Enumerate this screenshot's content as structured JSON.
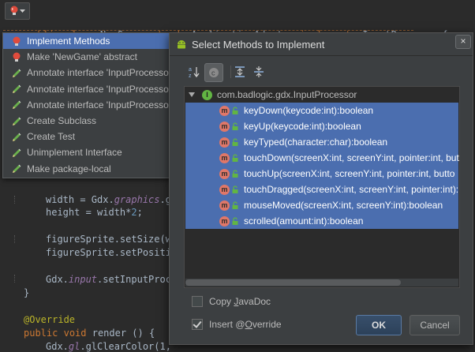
{
  "editor": {
    "class_decl": {
      "kw1": "public",
      "kw2": "class",
      "name": "NewGame",
      "kw3": "extends",
      "super": "ApplicationAdapter",
      "kw4": "implements",
      "iface": "InputProcessor{"
    },
    "lines": {
      "width_assign_pre": "width = Gdx.",
      "width_assign_field": "graphics",
      "width_assign_post": ".g",
      "height_assign_pre": "height = width*",
      "height_assign_num": "2",
      "height_assign_post": ";",
      "setsize": "figureSprite.setSize(w",
      "setpos": "figureSprite.setPositi",
      "input_pre": "Gdx.",
      "input_field": "input",
      "input_post": ".setInputProc",
      "close_brace": "}",
      "override": "@Override",
      "render_kw1": "public",
      "render_kw2": "void",
      "render_post": "render () {",
      "clear_pre": "Gdx.",
      "clear_field": "gl",
      "clear_post": ".glClearColor(1,"
    }
  },
  "intent_popup": {
    "items": [
      {
        "label": "Implement Methods",
        "icon": "red-bulb-icon"
      },
      {
        "label": "Make 'NewGame' abstract",
        "icon": "red-bulb-icon"
      },
      {
        "label": "Annotate interface 'InputProcesso",
        "icon": "pencil-icon"
      },
      {
        "label": "Annotate interface 'InputProcesso",
        "icon": "pencil-icon"
      },
      {
        "label": "Annotate interface 'InputProcesso",
        "icon": "pencil-icon"
      },
      {
        "label": "Create Subclass",
        "icon": "pencil-icon"
      },
      {
        "label": "Create Test",
        "icon": "pencil-icon"
      },
      {
        "label": "Unimplement Interface",
        "icon": "pencil-icon"
      },
      {
        "label": "Make package-local",
        "icon": "pencil-icon"
      }
    ]
  },
  "dialog": {
    "title": "Select Methods to Implement",
    "close_glyph": "×",
    "tree_root": "com.badlogic.gdx.InputProcessor",
    "root_badge": "I",
    "method_badge": "m",
    "methods": [
      "keyDown(keycode:int):boolean",
      "keyUp(keycode:int):boolean",
      "keyTyped(character:char):boolean",
      "touchDown(screenX:int, screenY:int, pointer:int, but",
      "touchUp(screenX:int, screenY:int, pointer:int, butto",
      "touchDragged(screenX:int, screenY:int, pointer:int):",
      "mouseMoved(screenX:int, screenY:int):boolean",
      "scrolled(amount:int):boolean"
    ],
    "copy_javadoc": {
      "pre": "Copy ",
      "u": "J",
      "post": "avaDoc",
      "checked": false
    },
    "insert_override": {
      "pre": "Insert @",
      "u": "O",
      "post": "verride",
      "checked": true
    },
    "ok_label": "OK",
    "cancel_label": "Cancel"
  },
  "colors": {
    "selection": "#4b6eaf",
    "keyword": "#cc7832",
    "field": "#9876aa",
    "annotation": "#bbb529",
    "bulb_red": "#e04b3c",
    "pencil_green": "#6ab04c"
  }
}
